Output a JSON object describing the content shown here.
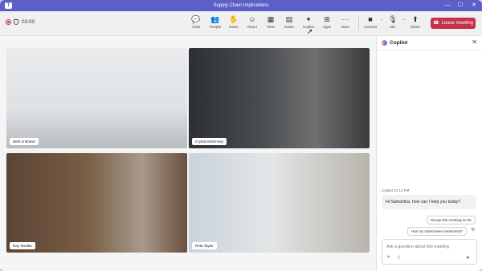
{
  "window": {
    "title": "Supply Chain Implications",
    "app_logo": "T"
  },
  "window_controls": {
    "minimize": "—",
    "restore": "☐",
    "close": "✕"
  },
  "meeting": {
    "timer": "03:00"
  },
  "toolbar": {
    "buttons": [
      {
        "label": "Chat",
        "icon": "chat-icon",
        "glyph": "💬"
      },
      {
        "label": "People",
        "icon": "people-icon",
        "glyph": "👥"
      },
      {
        "label": "Raise",
        "icon": "raise-hand-icon",
        "glyph": "✋"
      },
      {
        "label": "React",
        "icon": "react-icon",
        "glyph": "☺"
      },
      {
        "label": "View",
        "icon": "view-icon",
        "glyph": "▦"
      },
      {
        "label": "Notes",
        "icon": "notes-icon",
        "glyph": "▤"
      },
      {
        "label": "Copilot",
        "icon": "copilot-icon",
        "glyph": "✦"
      },
      {
        "label": "Apps",
        "icon": "apps-icon",
        "glyph": "⊞"
      },
      {
        "label": "More",
        "icon": "more-icon",
        "glyph": "···"
      },
      {
        "label": "Camera",
        "icon": "camera-icon",
        "glyph": "■"
      },
      {
        "label": "Mic",
        "icon": "mic-icon",
        "glyph": "🎙"
      },
      {
        "label": "Share",
        "icon": "share-icon",
        "glyph": "⬆"
      }
    ],
    "chevron": "⌄",
    "leave_label": "Leave meeting",
    "leave_glyph": "☎"
  },
  "participants": [
    {
      "name": "Beth Andrews"
    },
    {
      "name": "Crystal McKinney"
    },
    {
      "name": "Ray Tanaka"
    },
    {
      "name": "Reta Taylor"
    }
  ],
  "copilot": {
    "title": "Copilot",
    "close_glyph": "✕",
    "message_meta": "Copilot  12:12 PM",
    "message": "Hi Samantha, how can I help you today?",
    "suggestions": [
      "Recap this meeting so far",
      "Has my name been mentioned?"
    ],
    "refresh_glyph": "↻",
    "input_placeholder": "Ask a question about this meeting",
    "attach_glyph": "⌖",
    "clip_glyph": "⌇",
    "send_glyph": "➤"
  },
  "colors": {
    "accent": "#5b5fc7",
    "leave": "#c4314b"
  }
}
